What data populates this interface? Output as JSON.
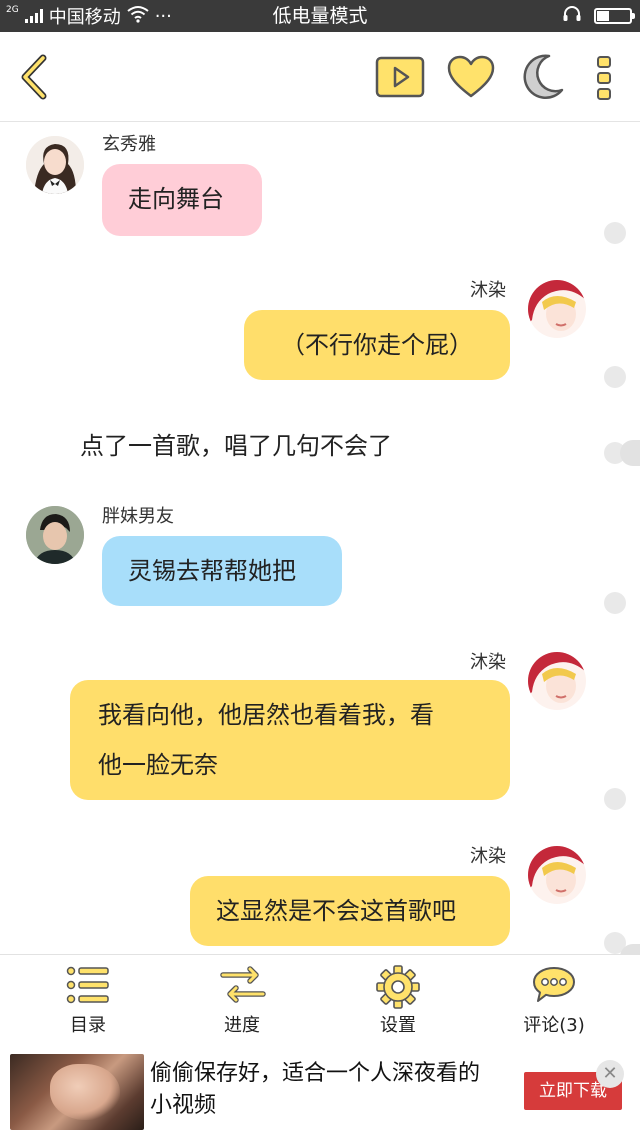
{
  "status_bar": {
    "network": "2G",
    "carrier": "中国移动",
    "dots": "···",
    "mode_title": "低电量模式",
    "battery_level": 0.35
  },
  "toolbar": {
    "back_icon": "chevron-left-icon",
    "play_icon": "play-icon",
    "like_icon": "heart-icon",
    "night_icon": "moon-icon",
    "more_icon": "more-vertical-icon"
  },
  "chat": {
    "messages": [
      {
        "speaker": "玄秀雅",
        "text": "走向舞台",
        "side": "left",
        "color": "pink"
      },
      {
        "speaker": "沐染",
        "text": "（不行你走个屁）",
        "side": "right",
        "color": "yellow"
      },
      {
        "narration": "点了一首歌，唱了几句不会了"
      },
      {
        "speaker": "胖妹男友",
        "text": "灵锡去帮帮她把",
        "side": "left",
        "color": "blue"
      },
      {
        "speaker": "沐染",
        "text_line1": "我看向他，他居然也看着我，看",
        "text_line2": "他一脸无奈",
        "side": "right",
        "color": "yellow"
      },
      {
        "speaker": "沐染",
        "text": "这显然是不会这首歌吧",
        "side": "right",
        "color": "yellow"
      }
    ]
  },
  "bottom_nav": {
    "items": [
      {
        "label": "目录",
        "icon": "list-icon"
      },
      {
        "label": "进度",
        "icon": "swap-arrows-icon"
      },
      {
        "label": "设置",
        "icon": "gear-icon"
      },
      {
        "label": "评论(3)",
        "icon": "comment-icon"
      }
    ]
  },
  "ad": {
    "text": "偷偷保存好，适合一个人深夜看的小视频",
    "cta": "立即下载",
    "close": "✕"
  },
  "colors": {
    "accent_yellow": "#ffde6b",
    "icon_yellow": "#ffe26b",
    "pink_bubble": "#ffcdd7",
    "blue_bubble": "#a8defa",
    "cta_red": "#d63b3b"
  }
}
